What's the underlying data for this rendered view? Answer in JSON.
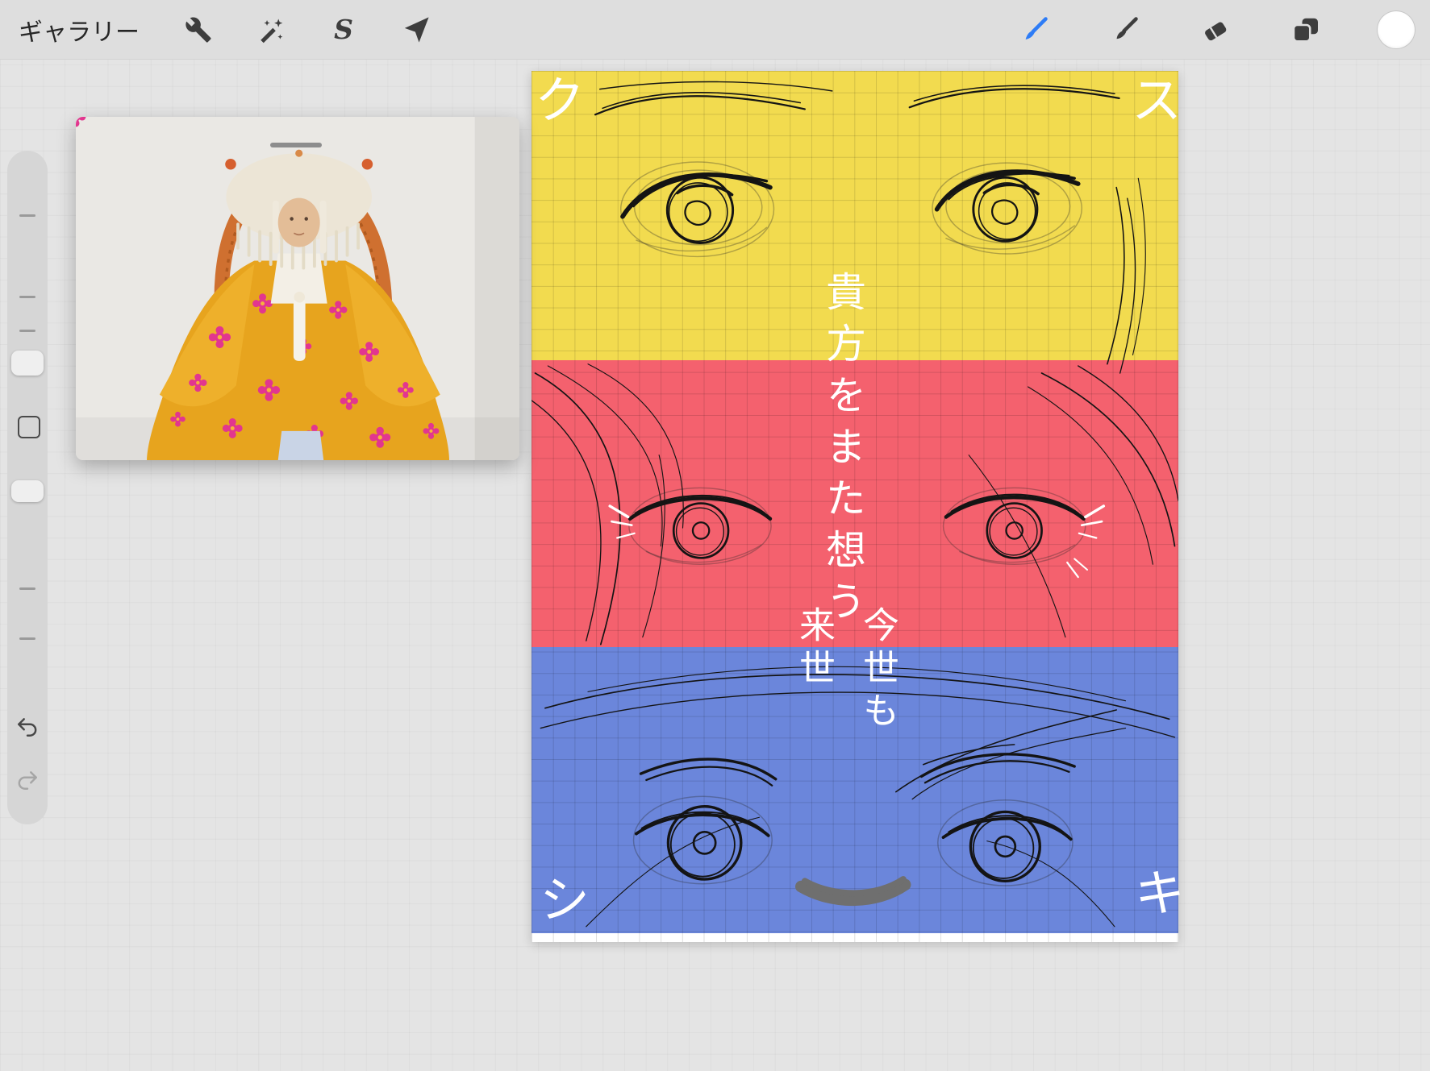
{
  "topbar": {
    "gallery_label": "ギャラリー",
    "selection_label": "S",
    "accent_color": "#2E7CF6",
    "left_tools": [
      "gallery",
      "actions-wrench",
      "adjustments-wand",
      "selection",
      "transform-arrow"
    ],
    "right_tools": [
      "paint-brush",
      "smudge",
      "eraser",
      "layers",
      "color"
    ],
    "active_tool": "paint-brush"
  },
  "sidebar": {
    "controls": [
      "brush-size-slider",
      "modify-button",
      "opacity-slider",
      "undo",
      "redo"
    ]
  },
  "reference_window": {
    "alt": "Reference photo: person wearing a white beaded headdress with orange braids and a yellow floral robe"
  },
  "canvas": {
    "band_colors": {
      "top": "#F2DB4F",
      "middle": "#F4616E",
      "bottom": "#6B86DB"
    },
    "grid_color": "rgba(0,0,0,0.13)",
    "text_color": "#FFFFFF",
    "texts": {
      "corner_top_left": "ク",
      "corner_top_right": "ス",
      "corner_bottom_left": "シ",
      "corner_bottom_right": "キ",
      "vertical_main": "貴方をまた想う",
      "vertical_right": "今世も",
      "vertical_left": "来世"
    }
  }
}
